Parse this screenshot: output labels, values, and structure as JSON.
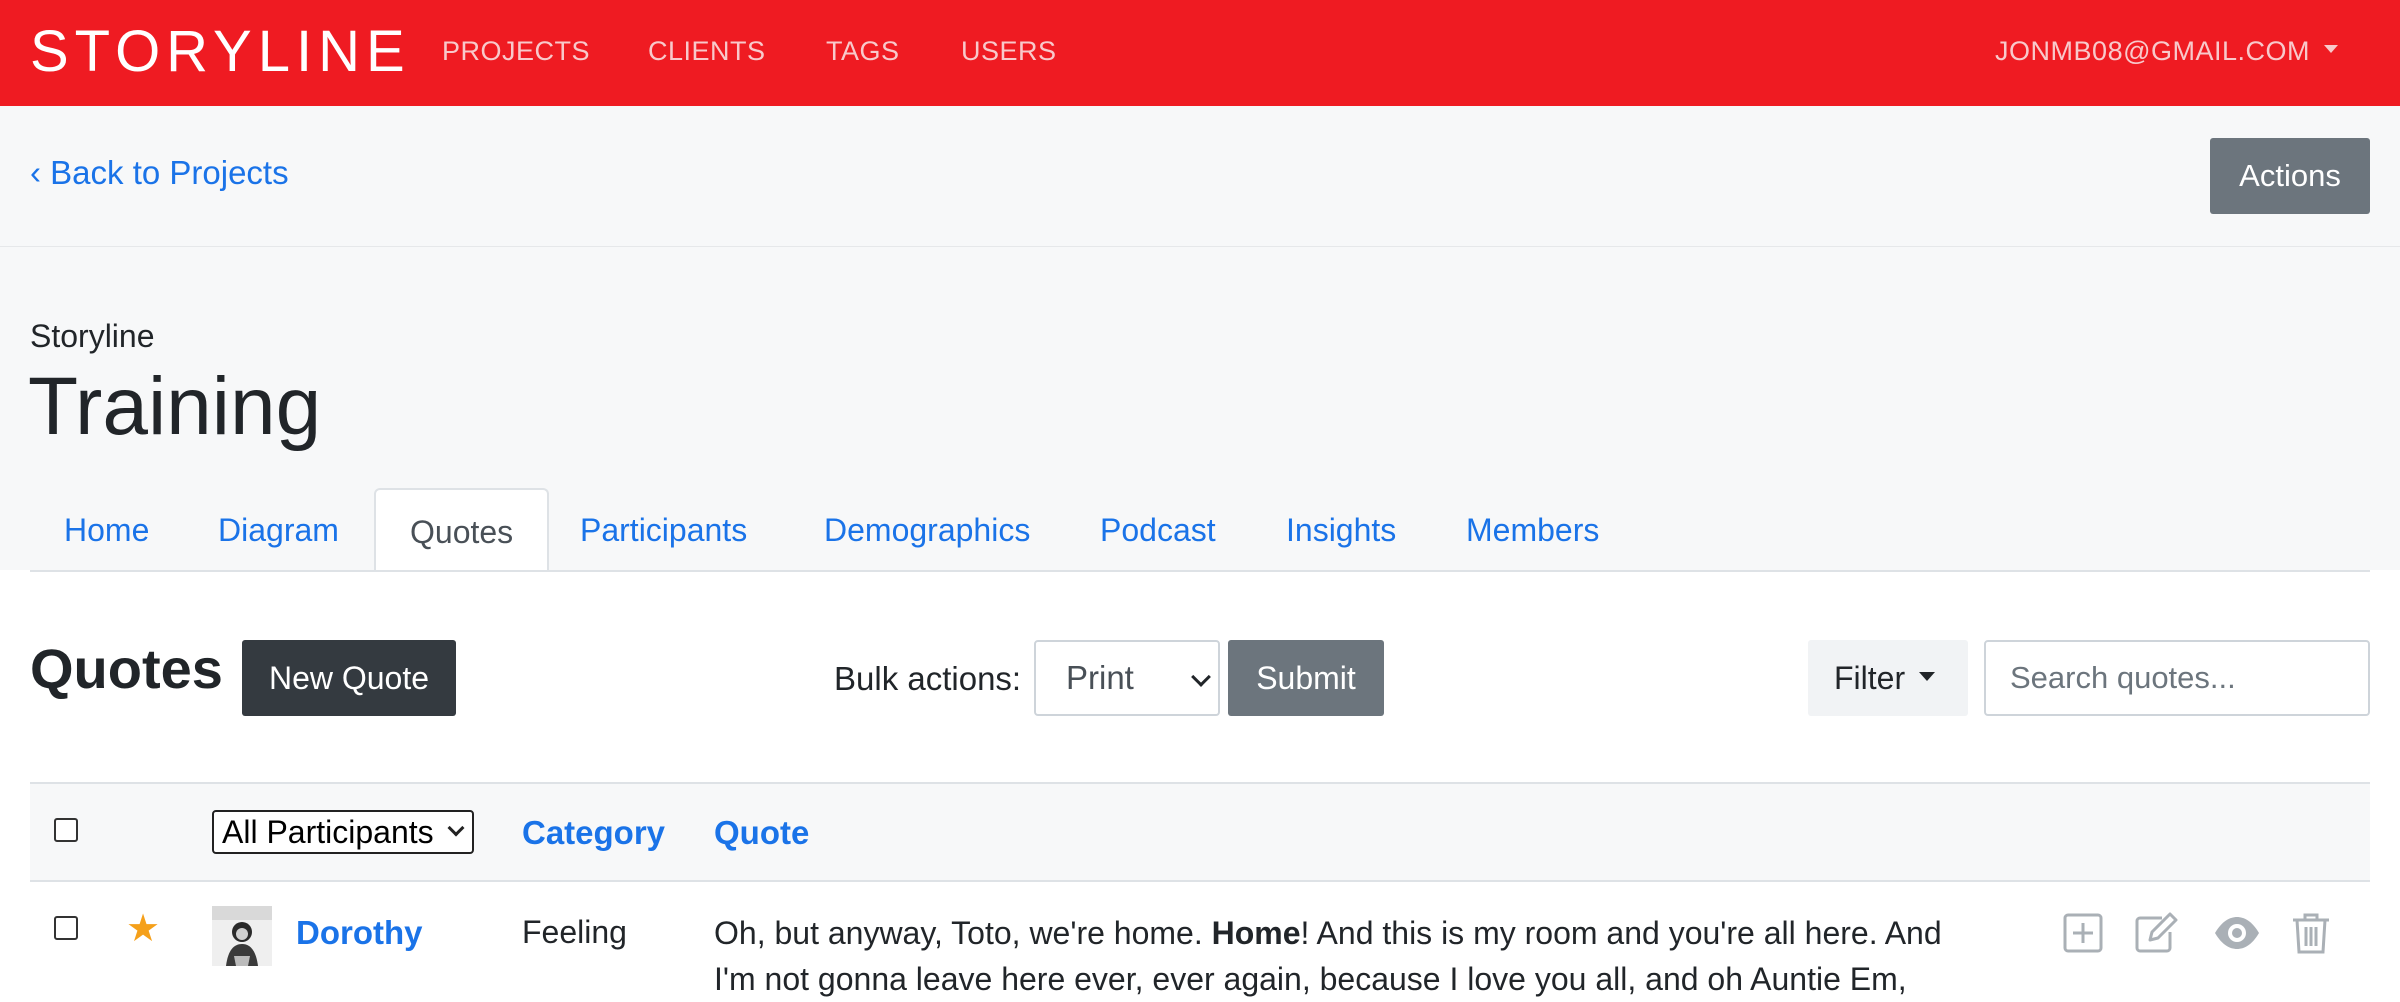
{
  "navbar": {
    "brand": "STORYLINE",
    "links": [
      "PROJECTS",
      "CLIENTS",
      "TAGS",
      "USERS"
    ],
    "user_email": "JONMB08@GMAIL.COM",
    "bg_color": "#ef1b22"
  },
  "header": {
    "back_link": "‹ Back to Projects",
    "actions_label": "Actions",
    "org_name": "Storyline",
    "project_title": "Training"
  },
  "tabs": [
    {
      "label": "Home",
      "active": false
    },
    {
      "label": "Diagram",
      "active": false
    },
    {
      "label": "Quotes",
      "active": true
    },
    {
      "label": "Participants",
      "active": false
    },
    {
      "label": "Demographics",
      "active": false
    },
    {
      "label": "Podcast",
      "active": false
    },
    {
      "label": "Insights",
      "active": false
    },
    {
      "label": "Members",
      "active": false
    }
  ],
  "toolbar": {
    "heading": "Quotes",
    "new_quote_label": "New Quote",
    "bulk_label": "Bulk actions:",
    "bulk_selected": "Print",
    "submit_label": "Submit",
    "filter_label": "Filter",
    "search_placeholder": "Search quotes..."
  },
  "table": {
    "participants_filter": "All Participants",
    "columns": {
      "category": "Category",
      "quote": "Quote"
    },
    "rows": [
      {
        "starred": true,
        "participant": "Dorothy",
        "category": "Feeling",
        "quote_before": "Oh, but anyway, Toto, we're home. ",
        "quote_bold": "Home",
        "quote_after": "! And this is my room and you're all here. And I'm not gonna leave here ever, ever again, because I love you all, and oh Auntie Em,",
        "actions": [
          "add-icon",
          "edit-icon",
          "view-icon",
          "delete-icon"
        ]
      }
    ]
  }
}
